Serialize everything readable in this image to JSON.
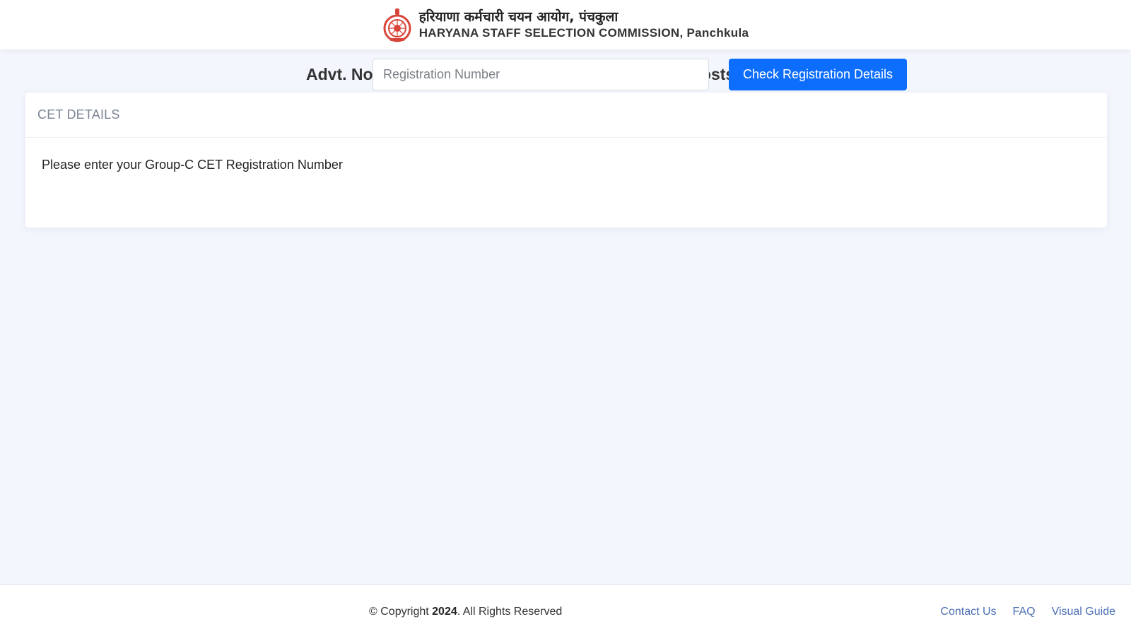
{
  "header": {
    "org_name_hindi": "हरियाणा कर्मचारी चयन आयोग, पंचकुला",
    "org_name_english": "HARYANA STAFF SELECTION COMMISSION, Panchkula",
    "logo_icon": "haryana-emblem-icon",
    "logo_color": "#d9443a"
  },
  "page": {
    "title": "Advt. No 07 /2024 - Online Application for various posts of Group-C"
  },
  "cet_card": {
    "heading": "CET DETAILS",
    "prompt_label": "Please enter your Group-C CET Registration Number",
    "input_placeholder": "Registration Number",
    "input_value": "",
    "button_label": "Check Registration Details",
    "button_color": "#0d6efd"
  },
  "footer": {
    "copyright_prefix": "© Copyright ",
    "copyright_year": "2024",
    "copyright_suffix": ". All Rights Reserved",
    "links": [
      "Contact Us",
      "FAQ",
      "Visual Guide"
    ]
  }
}
